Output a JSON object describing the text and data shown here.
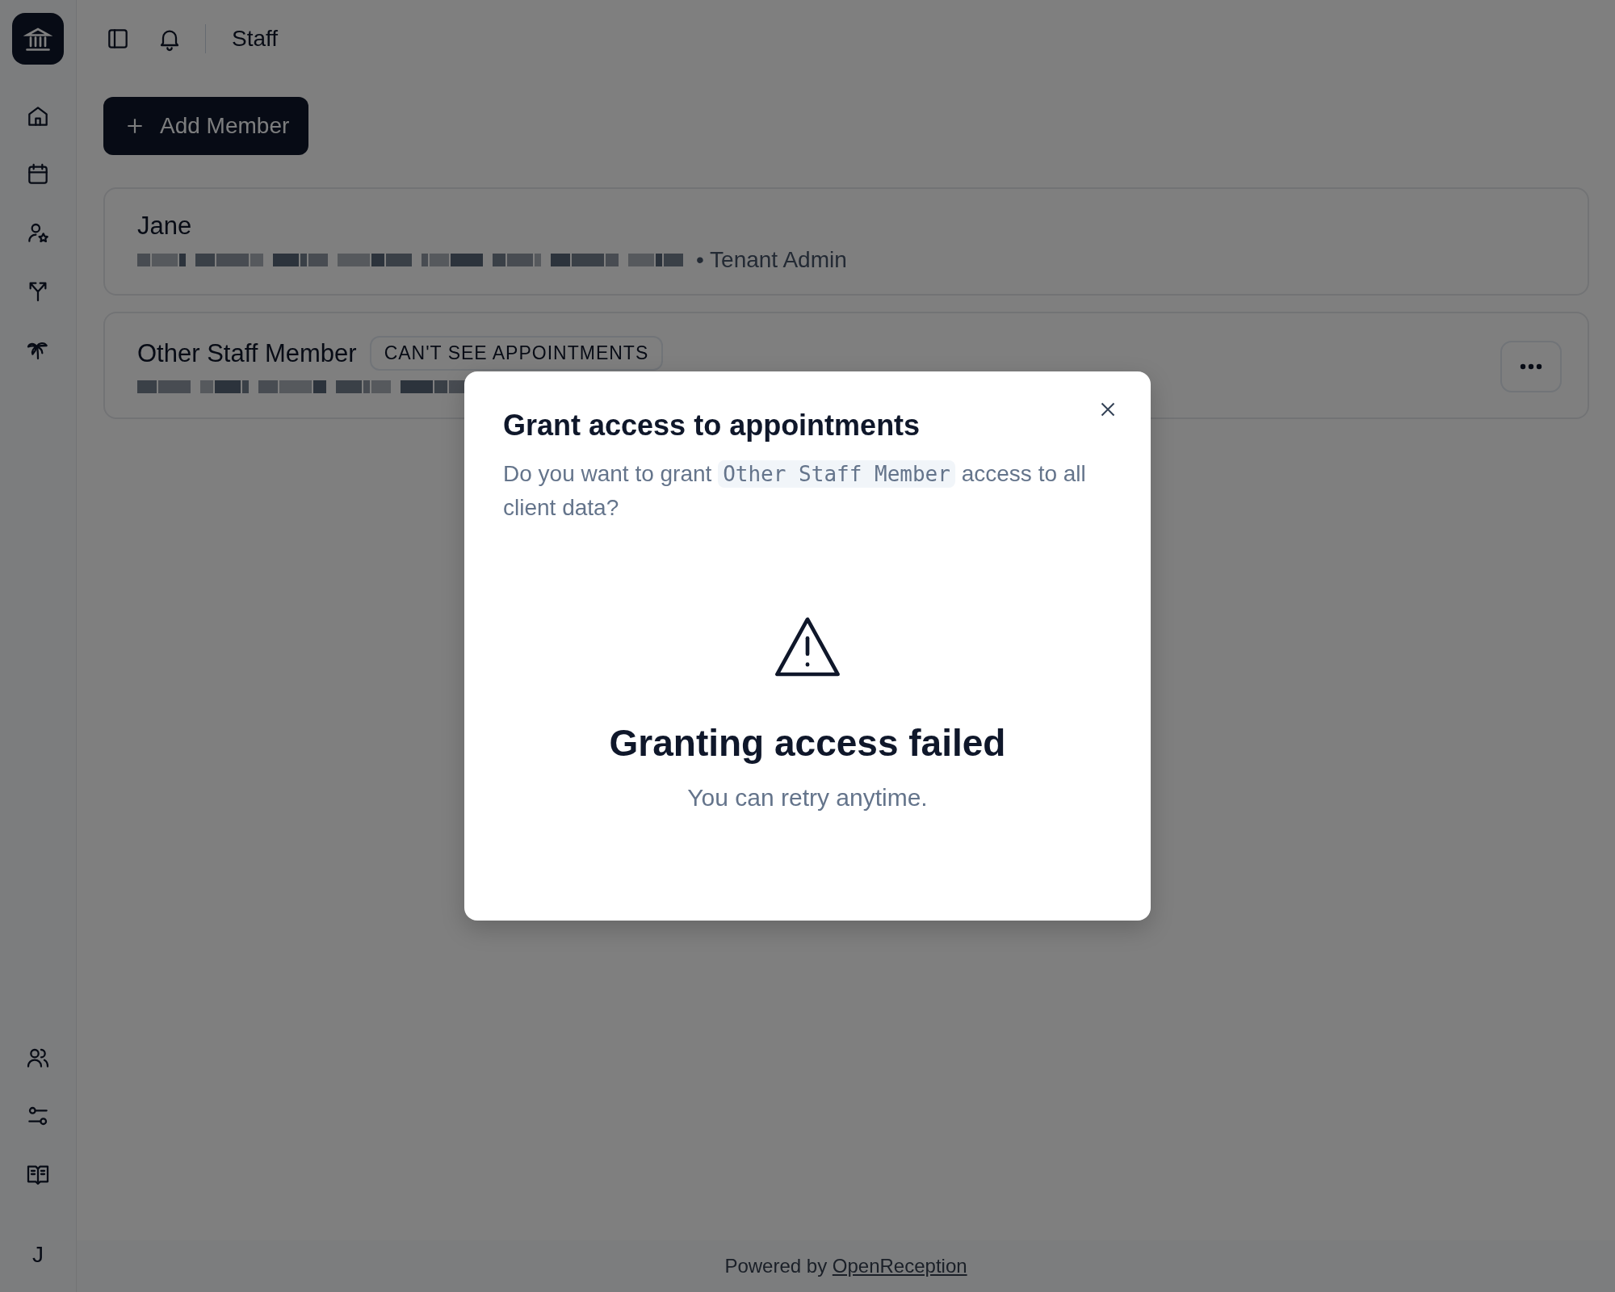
{
  "topbar": {
    "title": "Staff"
  },
  "add_button": {
    "label": "Add Member"
  },
  "members": [
    {
      "name": "Jane",
      "role": "• Tenant Admin",
      "has_menu": false
    },
    {
      "name": "Other Staff Member",
      "badge": "CAN'T SEE APPOINTMENTS",
      "has_menu": true
    }
  ],
  "user_avatar": {
    "initial": "J"
  },
  "footer": {
    "text": "Powered by",
    "link": "OpenReception"
  },
  "dialog": {
    "title": "Grant access to appointments",
    "message_before": "Do you want to grant",
    "message_code": "Other Staff Member",
    "message_after": "access to all client data?",
    "status_title": "Granting access failed",
    "status_text": "You can retry anytime."
  }
}
